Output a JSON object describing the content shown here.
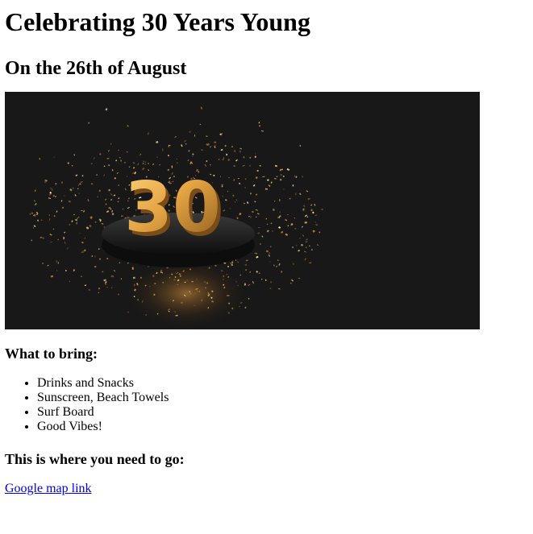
{
  "header": {
    "title": "Celebrating 30 Years Young",
    "subtitle": "On the 26th of August"
  },
  "hero": {
    "number_text": "30",
    "background_color": "#181818",
    "accent_color": "#e0a040"
  },
  "bring": {
    "heading": "What to bring:",
    "items": [
      "Drinks and Snacks",
      "Sunscreen, Beach Towels",
      "Surf Board",
      "Good Vibes!"
    ]
  },
  "directions": {
    "heading": "This is where you need to go:",
    "link_text": "Google map link"
  },
  "colors": {
    "link": "#0000ee",
    "text": "#000000"
  }
}
